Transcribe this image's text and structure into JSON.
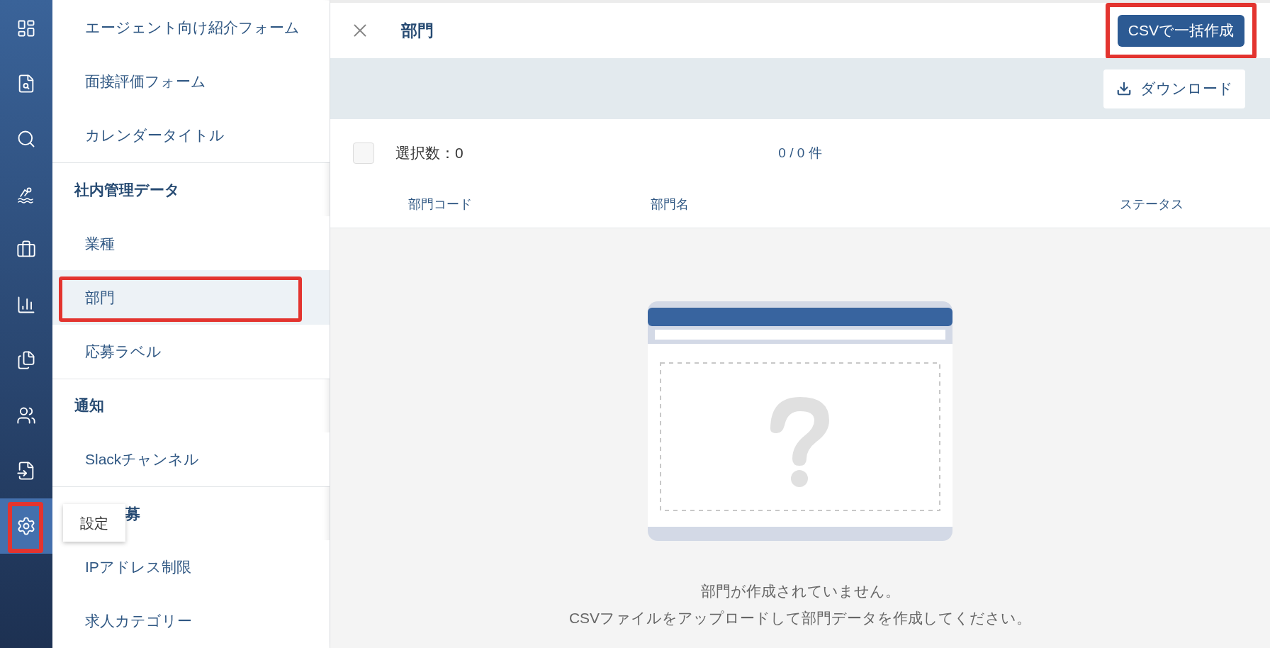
{
  "rail": {
    "items": [
      {
        "selected": false,
        "highlighted": false
      },
      {
        "selected": false,
        "highlighted": false
      },
      {
        "selected": false,
        "highlighted": false
      },
      {
        "selected": false,
        "highlighted": false
      },
      {
        "selected": false,
        "highlighted": false
      },
      {
        "selected": false,
        "highlighted": false
      },
      {
        "selected": false,
        "highlighted": false
      },
      {
        "selected": false,
        "highlighted": false
      },
      {
        "selected": false,
        "highlighted": false
      },
      {
        "selected": true,
        "highlighted": true
      }
    ]
  },
  "tooltip": {
    "label": "設定"
  },
  "menu": {
    "items": [
      {
        "kind": "item",
        "label": "エージェント向け紹介フォーム",
        "selected": false,
        "highlighted": false
      },
      {
        "kind": "item",
        "label": "面接評価フォーム",
        "selected": false,
        "highlighted": false
      },
      {
        "kind": "item",
        "label": "カレンダータイトル",
        "selected": false,
        "highlighted": false
      },
      {
        "kind": "heading",
        "label": "社内管理データ",
        "covered": false
      },
      {
        "kind": "item",
        "label": "業種",
        "selected": false,
        "highlighted": false
      },
      {
        "kind": "item",
        "label": "部門",
        "selected": true,
        "highlighted": true
      },
      {
        "kind": "item",
        "label": "応募ラベル",
        "selected": false,
        "highlighted": false
      },
      {
        "kind": "heading",
        "label": "通知",
        "covered": false
      },
      {
        "kind": "item",
        "label": "Slackチャンネル",
        "selected": false,
        "highlighted": false
      },
      {
        "kind": "heading",
        "label": "募",
        "covered": true
      },
      {
        "kind": "item",
        "label": "IPアドレス制限",
        "selected": false,
        "highlighted": false
      },
      {
        "kind": "item",
        "label": "求人カテゴリー",
        "selected": false,
        "highlighted": false
      }
    ]
  },
  "panel": {
    "title": "部門",
    "create_button": {
      "label": "CSVで一括作成",
      "highlighted": true
    },
    "download_button": {
      "label": "ダウンロード"
    },
    "selection": {
      "label": "選択数：0",
      "checked": false
    },
    "count": "0 / 0 件",
    "columns": [
      "部門コード",
      "部門名",
      "ステータス"
    ],
    "empty_message": [
      "部門が作成されていません。",
      "CSVファイルをアップロードして部門データを作成してください。"
    ]
  }
}
